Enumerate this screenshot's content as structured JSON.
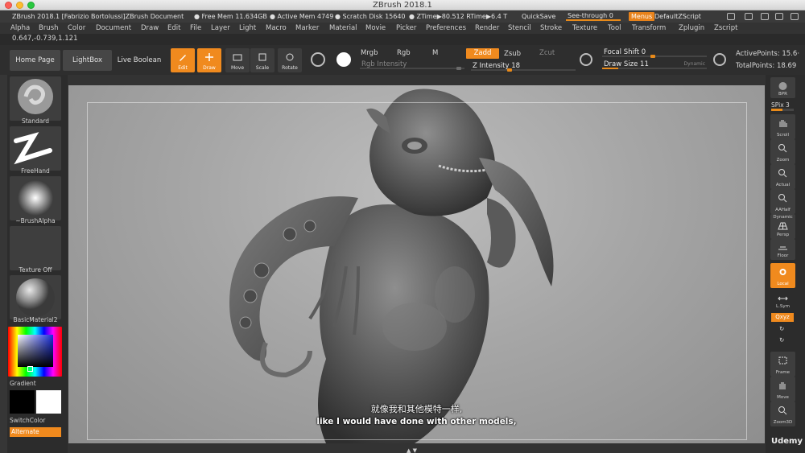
{
  "window": {
    "title": "ZBrush 2018.1"
  },
  "infobar": {
    "doc": "ZBrush 2018.1 [Fabrizio Bortolussi]ZBrush Document",
    "free_mem": "● Free Mem 11.634GB",
    "active_mem": "● Active Mem 4749",
    "scratch": "● Scratch Disk 15640",
    "ztime": "● ZTime▶80.512 RTime▶6.4 T",
    "quicksave": "QuickSave",
    "see_through": "See-through  0",
    "menus": "Menus",
    "default_zscript": "DefaultZScript"
  },
  "menu": [
    "Alpha",
    "Brush",
    "Color",
    "Document",
    "Draw",
    "Edit",
    "File",
    "Layer",
    "Light",
    "Macro",
    "Marker",
    "Material",
    "Movie",
    "Picker",
    "Preferences",
    "Render",
    "Stencil",
    "Stroke",
    "Texture",
    "Tool",
    "Transform",
    "Zplugin",
    "Zscript"
  ],
  "coords": "0.647,-0.739,1.121",
  "shelf": {
    "home_page": "Home Page",
    "lightbox": "LightBox",
    "live_boolean": "Live Boolean",
    "edit": "Edit",
    "draw": "Draw",
    "move": "Move",
    "scale": "Scale",
    "rotate": "Rotate",
    "mrgb": "Mrgb",
    "rgb": "Rgb",
    "m": "M",
    "zadd": "Zadd",
    "zsub": "Zsub",
    "zcut": "Zcut",
    "rgb_intensity": "Rgb Intensity",
    "z_intensity": "Z Intensity 18",
    "focal_shift": "Focal Shift 0",
    "draw_size": "Draw Size 11",
    "dynamic": "Dynamic",
    "active_points": "ActivePoints: 15.6·",
    "total_points": "TotalPoints: 18.69"
  },
  "left": {
    "brush": "Standard",
    "stroke": "FreeHand",
    "alpha": "~BrushAlpha",
    "texture": "Texture Off",
    "material": "BasicMaterial2",
    "gradient": "Gradient",
    "switch_color": "SwitchColor",
    "alternate": "Alternate"
  },
  "right": {
    "bpr": "BPR",
    "spix": "SPix 3",
    "scroll": "Scroll",
    "zoom": "Zoom",
    "actual": "Actual",
    "aahalf": "AAHalf",
    "dynamic": "Dynamic",
    "persp": "Persp",
    "floor": "Floor",
    "local": "Local",
    "lsym": "L.Sym",
    "xyz": "Qxyz",
    "frame": "Frame",
    "move": "Move",
    "zoom3d": "Zoom3D",
    "udemy": "Udemy"
  },
  "subtitles": {
    "cn": "就像我和其他模特一样,",
    "en": "like I would have done with other models,"
  },
  "colors": {
    "accent": "#f08a1e",
    "panel": "#2c2c2c",
    "canvas": "#a6a6a6"
  }
}
